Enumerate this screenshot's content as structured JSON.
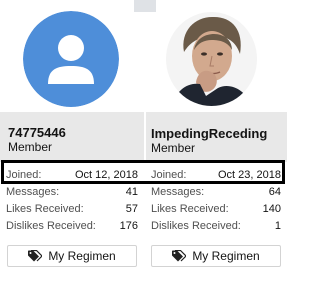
{
  "colors": {
    "avatar_default": "#4e8ed9",
    "card_shade": "#e8e8e8",
    "highlight_border": "#000000"
  },
  "members": [
    {
      "username": "74775446",
      "title": "Member",
      "avatar": "default-user-avatar-icon",
      "stats": [
        {
          "label": "Joined:",
          "value": "Oct 12, 2018"
        },
        {
          "label": "Messages:",
          "value": "41"
        },
        {
          "label": "Likes Received:",
          "value": "57"
        },
        {
          "label": "Dislikes Received:",
          "value": "176"
        }
      ],
      "button_label": "My Regimen"
    },
    {
      "username": "ImpedingReceding",
      "title": "Member",
      "avatar": "user-photo",
      "stats": [
        {
          "label": "Joined:",
          "value": "Oct 23, 2018"
        },
        {
          "label": "Messages:",
          "value": "64"
        },
        {
          "label": "Likes Received:",
          "value": "140"
        },
        {
          "label": "Dislikes Received:",
          "value": "1"
        }
      ],
      "button_label": "My Regimen"
    }
  ]
}
